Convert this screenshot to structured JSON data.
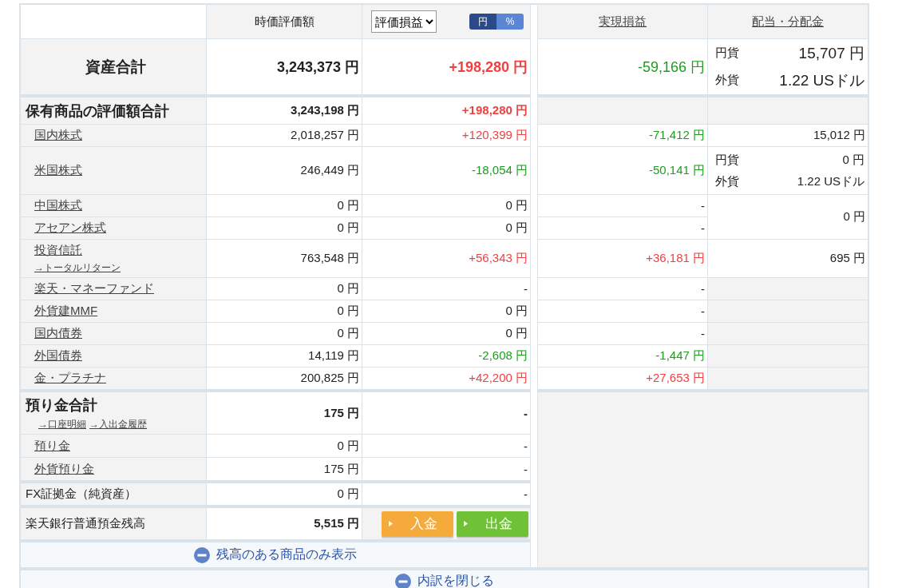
{
  "header": {
    "market_value": "時価評価額",
    "profit_select": "評価損益",
    "unit_toggle": [
      {
        "label": "円",
        "selected": true
      },
      {
        "label": "%",
        "selected": false
      }
    ],
    "realized": "実現損益",
    "dividend": "配当・分配金"
  },
  "total": {
    "label": "資産合計",
    "value": "3,243,373 円",
    "pl": {
      "text": "+198,280 円",
      "color": "#f24040"
    },
    "realized": {
      "text": "-59,166 円",
      "color": "#1c9e1c"
    },
    "dividend": {
      "kind": "split",
      "lines": [
        {
          "currency": "円貨",
          "amount": "15,707 円"
        },
        {
          "currency": "外貨",
          "amount": "1.22 USドル"
        }
      ]
    }
  },
  "holdings": {
    "label": "保有商品の評価額合計",
    "value": "3,243,198 円",
    "pl": {
      "text": "+198,280 円",
      "color": "#f24040"
    },
    "items": [
      {
        "label": "国内株式",
        "value": "2,018,257 円",
        "pl": {
          "text": "+120,399 円",
          "color": "#f24040"
        },
        "realized": {
          "text": "-71,412 円",
          "color": "#1c9e1c"
        },
        "dividend": {
          "kind": "amount",
          "text": "15,012 円"
        }
      },
      {
        "label": "米国株式",
        "value": "246,449 円",
        "pl": {
          "text": "-18,054 円",
          "color": "#1c9e1c"
        },
        "realized": {
          "text": "-50,141 円",
          "color": "#1c9e1c"
        },
        "dividend": {
          "kind": "split",
          "lines": [
            {
              "currency": "円貨",
              "amount": "0 円"
            },
            {
              "currency": "外貨",
              "amount": "1.22 USドル"
            }
          ]
        }
      },
      {
        "label": "中国株式",
        "value": "0 円",
        "pl": {
          "text": "0 円"
        },
        "realized": {
          "text": "-"
        },
        "dividend": {
          "kind": "amount",
          "text": "0 円"
        }
      },
      {
        "label": "アセアン株式",
        "value": "0 円",
        "pl": {
          "text": "0 円"
        },
        "realized": {
          "text": "-"
        }
      },
      {
        "label": "投資信託",
        "sublink": "→トータルリターン",
        "value": "763,548 円",
        "pl": {
          "text": "+56,343 円",
          "color": "#f24040"
        },
        "realized": {
          "text": "+36,181 円",
          "color": "#f24040"
        },
        "dividend": {
          "kind": "amount",
          "text": "695 円"
        }
      },
      {
        "label": "楽天・マネーファンド",
        "value": "0 円",
        "pl": {
          "text": "-"
        },
        "realized": {
          "text": "-"
        },
        "dividend": {
          "kind": "empty"
        }
      },
      {
        "label": "外貨建MMF",
        "value": "0 円",
        "pl": {
          "text": "0 円"
        },
        "realized": {
          "text": "-"
        },
        "dividend": {
          "kind": "empty"
        }
      },
      {
        "label": "国内債券",
        "value": "0 円",
        "pl": {
          "text": "0 円"
        },
        "realized": {
          "text": "-"
        },
        "dividend": {
          "kind": "empty"
        }
      },
      {
        "label": "外国債券",
        "value": "14,119 円",
        "pl": {
          "text": "-2,608 円",
          "color": "#1c9e1c"
        },
        "realized": {
          "text": "-1,447 円",
          "color": "#1c9e1c"
        },
        "dividend": {
          "kind": "empty"
        }
      },
      {
        "label": "金・プラチナ",
        "value": "200,825 円",
        "pl": {
          "text": "+42,200 円",
          "color": "#f24040"
        },
        "realized": {
          "text": "+27,653 円",
          "color": "#f24040"
        },
        "dividend": {
          "kind": "empty"
        }
      }
    ]
  },
  "deposits": {
    "label": "預り金合計",
    "links": [
      "→口座明細",
      "→入出金履歴"
    ],
    "value": "175 円",
    "pl": "-",
    "items": [
      {
        "label": "預り金",
        "value": "0 円",
        "pl": "-"
      },
      {
        "label": "外貨預り金",
        "value": "175 円",
        "pl": "-"
      }
    ]
  },
  "fx": {
    "label": "FX証拠金（純資産）",
    "value": "0 円",
    "pl": "-"
  },
  "bank": {
    "label": "楽天銀行普通預金残高",
    "value": "5,515 円",
    "buttons": [
      {
        "label": "入金",
        "kind": "deposit"
      },
      {
        "label": "出金",
        "kind": "withdraw"
      }
    ]
  },
  "filter_link": "残高のある商品のみ表示",
  "collapse_link": "内訳を閉じる"
}
